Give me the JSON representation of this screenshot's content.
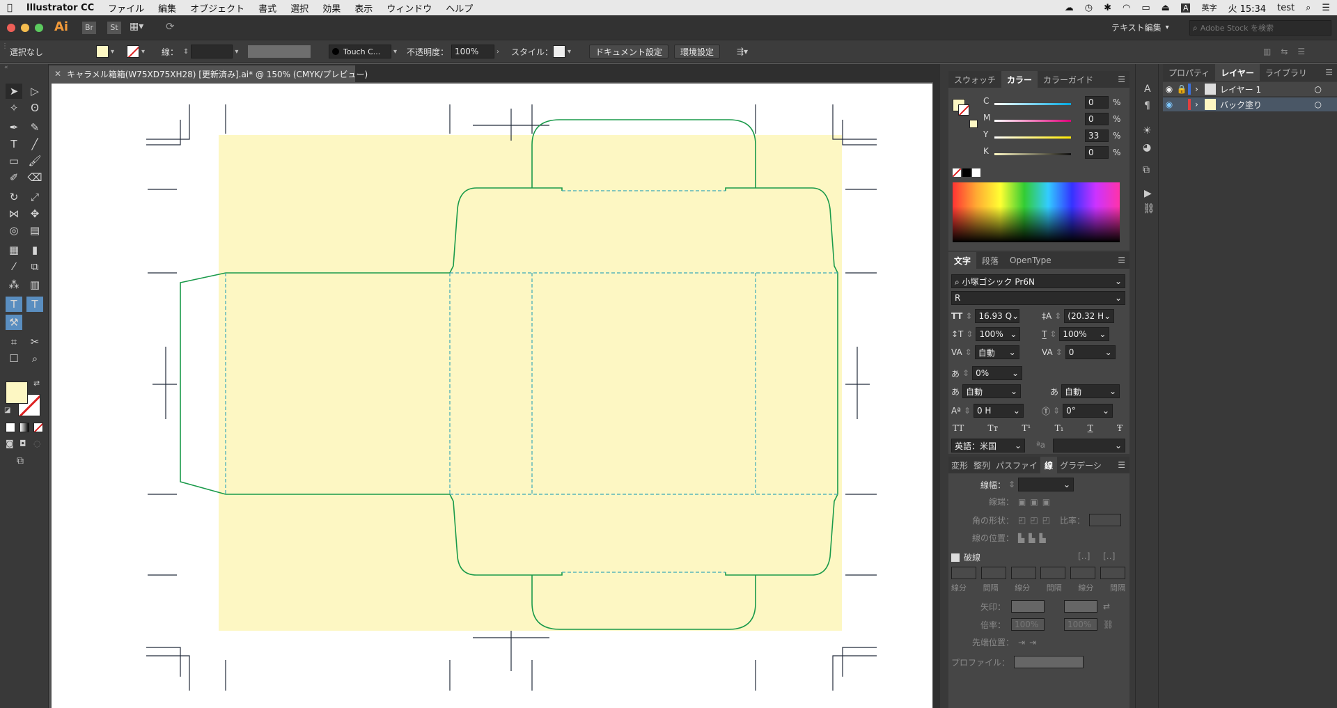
{
  "menubar": {
    "app_name": "Illustrator CC",
    "items": [
      "ファイル",
      "編集",
      "オブジェクト",
      "書式",
      "選択",
      "効果",
      "表示",
      "ウィンドウ",
      "ヘルプ"
    ],
    "input_source": "英字",
    "clock": "火 15:34",
    "user": "test"
  },
  "appbar": {
    "app_icon": "Ai",
    "br": "Br",
    "st": "St",
    "workspace": "テキスト編集",
    "stock_placeholder": "Adobe Stock を検索"
  },
  "control": {
    "selection": "選択なし",
    "stroke_label": "線：",
    "brush": "Touch C...",
    "opacity_label": "不透明度：",
    "opacity": "100%",
    "style_label": "スタイル：",
    "doc_settings": "ドキュメント設定",
    "prefs": "環境設定"
  },
  "document": {
    "tab_title": "キャラメル箱箱(W75XD75XH28) [更新済み].ai* @ 150% (CMYK/プレビュー)"
  },
  "colors": {
    "fill": "#fdf7c3",
    "dieline": "#1a9a4a",
    "fold": "#3aa8b8",
    "reg": "#222a3a"
  },
  "swatch_panel": {
    "tabs": [
      "スウォッチ",
      "カラー",
      "カラーガイド"
    ],
    "channels": [
      {
        "label": "C",
        "value": "0",
        "unit": "%"
      },
      {
        "label": "M",
        "value": "0",
        "unit": "%"
      },
      {
        "label": "Y",
        "value": "33",
        "unit": "%"
      },
      {
        "label": "K",
        "value": "0",
        "unit": "%"
      }
    ]
  },
  "char_panel": {
    "tabs": [
      "文字",
      "段落",
      "OpenType"
    ],
    "font_family": "小塚ゴシック Pr6N",
    "font_style": "R",
    "size": "16.93 Q",
    "leading": "(20.32 H",
    "vscale": "100%",
    "hscale": "100%",
    "kerning": "自動",
    "tracking": "0",
    "tsume": "0%",
    "aki_before": "自動",
    "aki_after": "自動",
    "baseline": "0 H",
    "rotation": "0°",
    "language": "英語：米国",
    "styles": [
      "TT",
      "Tт",
      "T¹",
      "T₁",
      "T",
      "Ŧ"
    ]
  },
  "stroke_panel": {
    "tabs": [
      "変形",
      "整列",
      "パスファイ",
      "線",
      "グラデーシ"
    ],
    "width_label": "線幅：",
    "cap_label": "線端：",
    "corner_label": "角の形状：",
    "limit_label": "比率：",
    "align_label": "線の位置：",
    "dashed_label": "破線",
    "dash_labels": [
      "線分",
      "間隔",
      "線分",
      "間隔",
      "線分",
      "間隔"
    ],
    "arrow_label": "矢印：",
    "scale_label": "倍率：",
    "scale_a": "100%",
    "scale_b": "100%",
    "arrow_pos_label": "先端位置：",
    "profile_label": "プロファイル："
  },
  "layers_panel": {
    "tabs": [
      "プロパティ",
      "レイヤー",
      "ライブラリ"
    ],
    "layers": [
      {
        "name": "レイヤー 1"
      },
      {
        "name": "バック塗り"
      }
    ]
  }
}
